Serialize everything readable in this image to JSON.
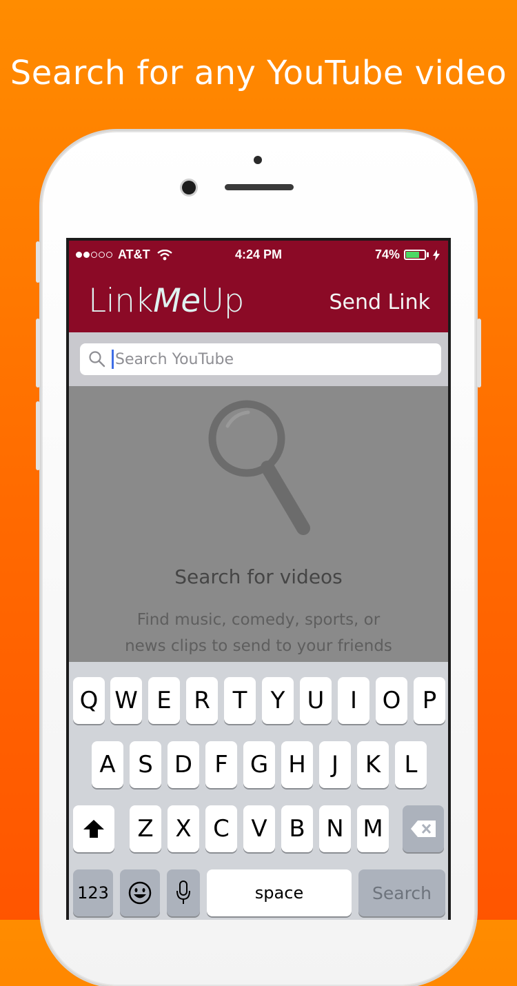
{
  "headline": "Search for any YouTube video",
  "status": {
    "carrier": "AT&T",
    "signal_icon": "signal-dots-icon",
    "wifi_icon": "wifi-icon",
    "time": "4:24 PM",
    "battery_percent": "74%",
    "battery_level": 0.74,
    "charging_icon": "bolt-icon"
  },
  "nav": {
    "brand_part1": "Link",
    "brand_part2": "Me",
    "brand_part3": "Up",
    "send_label": "Send Link"
  },
  "search": {
    "placeholder": "Search YouTube",
    "icon": "search-icon"
  },
  "empty_state": {
    "icon": "magnifier-icon",
    "title": "Search for videos",
    "line1": "Find music, comedy, sports, or",
    "line2": "news clips to send to your friends"
  },
  "keyboard": {
    "row1": [
      "Q",
      "W",
      "E",
      "R",
      "T",
      "Y",
      "U",
      "I",
      "O",
      "P"
    ],
    "row2": [
      "A",
      "S",
      "D",
      "F",
      "G",
      "H",
      "J",
      "K",
      "L"
    ],
    "row3": [
      "Z",
      "X",
      "C",
      "V",
      "B",
      "N",
      "M"
    ],
    "shift_icon": "shift-arrow-icon",
    "delete_icon": "backspace-icon",
    "numbers_label": "123",
    "emoji_icon": "emoji-icon",
    "mic_icon": "microphone-icon",
    "space_label": "space",
    "search_label": "Search"
  },
  "colors": {
    "background": "#ff7a00",
    "navbar": "#8b0a26",
    "brand_text": "#dff2f0",
    "battery": "#4cd964"
  }
}
